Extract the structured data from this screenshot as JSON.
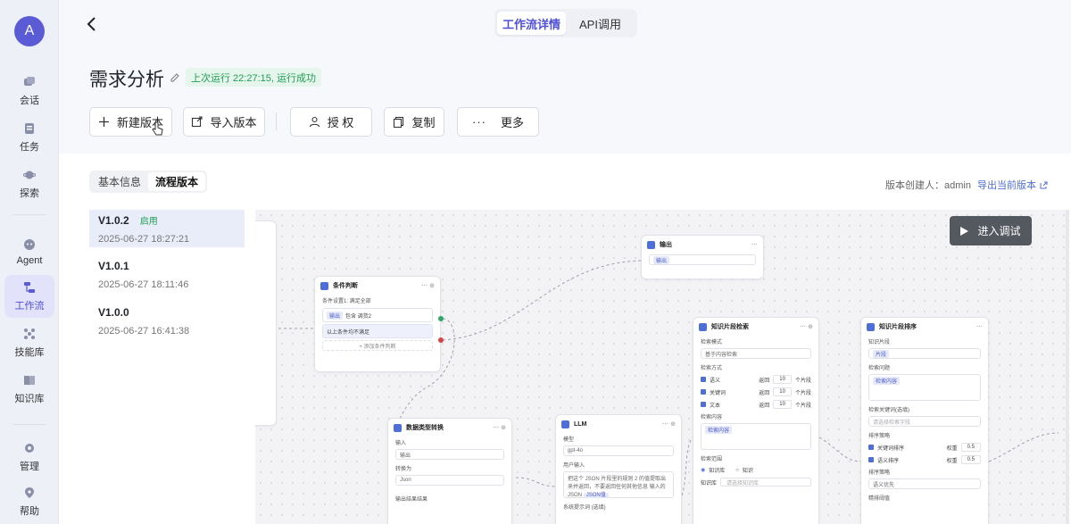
{
  "user": {
    "initial": "A"
  },
  "sidebar": {
    "items": [
      {
        "label": "会话",
        "icon": "chat-icon"
      },
      {
        "label": "任务",
        "icon": "task-icon"
      },
      {
        "label": "探索",
        "icon": "planet-icon"
      },
      {
        "label": "Agent",
        "icon": "agent-icon"
      },
      {
        "label": "工作流",
        "icon": "workflow-icon",
        "active": true
      },
      {
        "label": "技能库",
        "icon": "skills-icon"
      },
      {
        "label": "知识库",
        "icon": "book-icon"
      },
      {
        "label": "管理",
        "icon": "gear-icon"
      },
      {
        "label": "帮助",
        "icon": "help-icon"
      }
    ]
  },
  "header": {
    "tabs": [
      {
        "label": "工作流详情",
        "active": true
      },
      {
        "label": "API调用"
      }
    ],
    "title": "需求分析",
    "run_status": "上次运行 22:27:15, 运行成功"
  },
  "actions": {
    "new_version": "新建版本",
    "import_version": "导入版本",
    "authorize": "授 权",
    "copy": "复制",
    "more": "更多"
  },
  "subtabs": [
    {
      "label": "基本信息"
    },
    {
      "label": "流程版本",
      "active": true
    }
  ],
  "version_meta": {
    "creator": "版本创建人：admin",
    "export_current": "导出当前版本"
  },
  "versions": [
    {
      "name": "V1.0.2",
      "badge": "启用",
      "date": "2025-06-27 18:27:21",
      "active": true
    },
    {
      "name": "V1.0.1",
      "date": "2025-06-27 18:11:46"
    },
    {
      "name": "V1.0.0",
      "date": "2025-06-27 16:41:38"
    }
  ],
  "canvas": {
    "debug": "进入调试",
    "nodes": {
      "output": {
        "title": "输出",
        "field": "输出"
      },
      "condition": {
        "title": "条件判断",
        "label": "条件设置1: 满足全部",
        "cond1_a": "输出",
        "cond1_b": "包含 调货2",
        "cond2": "以上条件均不满足",
        "add": "+ 添加条件判断"
      },
      "convert": {
        "title": "数据类型转换",
        "in_label": "输入",
        "in_value": "输出",
        "to_label": "转换为",
        "to_value": "Json",
        "out_label": "输出结果结果"
      },
      "llm": {
        "title": "LLM",
        "model_label": "模型",
        "model_value": "gpt-4o",
        "user_label": "用户输入",
        "prompt": "把这个 JSON 片段里的规则 2 的值提取出来并返回，不要返回任何其他信息 输入的JSON",
        "prompt_var": "JSON值",
        "sys_label": "系统提示词 (选填)"
      },
      "retrieval": {
        "title": "知识片段检索",
        "mode_label": "检索模式",
        "mode_value": "基于内容检索",
        "way_label": "检索方式",
        "opt_semantic": "语义",
        "opt_keyword": "关键词",
        "opt_text": "文本",
        "ret": "返回",
        "num": "10",
        "unit": "个片段",
        "content_label": "检索内容",
        "content_value": "检索内容",
        "scope_label": "检索范围",
        "scope_kb": "知识库",
        "scope_file": "知识",
        "kb_label": "知识库",
        "kb_placeholder": "请选择知识库"
      },
      "rerank": {
        "title": "知识片段排序",
        "kb_label": "知识片段",
        "kb_chip": "片段",
        "q_label": "检索问题",
        "q_value": "检索内容",
        "kw_label": "检索关键词(选填)",
        "kw_placeholder": "请选择检索字段",
        "strategy_label": "排序策略",
        "r1": "关键词排序",
        "r2": "语义排序",
        "weight": "权重",
        "wv": "0.5",
        "pref_label": "排序策略",
        "pref_value": "语义优先",
        "threshold_label": "精排阈值"
      }
    }
  }
}
